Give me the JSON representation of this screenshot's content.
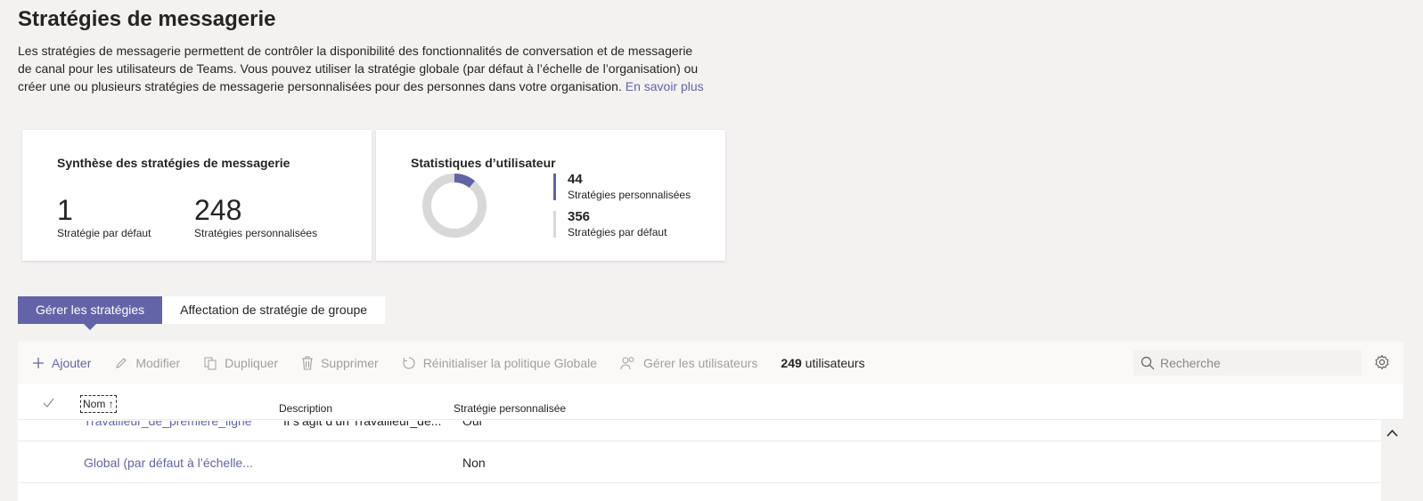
{
  "page": {
    "title": "Stratégies de messagerie",
    "intro": "Les stratégies de messagerie permettent de contrôler la disponibilité des fonctionnalités de conversation et de messagerie de canal pour les utilisateurs de Teams. Vous pouvez utiliser la stratégie globale (par défaut à l’échelle de l’organisation) ou créer une ou plusieurs stratégies de messagerie personnalisées pour des personnes dans votre organisation.",
    "learn_more": "En savoir plus"
  },
  "summary": {
    "title": "Synthèse des stratégies de messagerie",
    "default_count": "1",
    "default_label": "Stratégie par défaut",
    "custom_count": "248",
    "custom_label": "Stratégies personnalisées"
  },
  "user_stats": {
    "title": "Statistiques d’utilisateur",
    "custom_count": "44",
    "custom_label": "Stratégies personnalisées",
    "default_count": "356",
    "default_label": "Stratégies par défaut",
    "custom_fraction": 0.11,
    "colors": {
      "custom": "#6264a7",
      "default": "#d8d8d8"
    }
  },
  "tabs": [
    {
      "label": "Gérer les stratégies",
      "active": true
    },
    {
      "label": "Affectation de stratégie de groupe",
      "active": false
    }
  ],
  "toolbar": {
    "add": "Ajouter",
    "edit": "Modifier",
    "duplicate": "Dupliquer",
    "delete": "Supprimer",
    "reset": "Réinitialiser la politique Globale",
    "manage_users": "Gérer les utilisateurs",
    "users_count": "249",
    "users_label": "utilisateurs",
    "search_placeholder": "Recherche"
  },
  "table": {
    "columns": {
      "name": "Nom",
      "description": "Description",
      "custom": "Stratégie personnalisée"
    },
    "rows": [
      {
        "name": "Travailleur_de_première_ligne",
        "description": "Il s’agit d’un Travailleur_de...",
        "custom": "Oui"
      },
      {
        "name": "Global (par défaut à l’échelle...",
        "description": "",
        "custom": "Non"
      }
    ]
  },
  "colors": {
    "accent": "#6264a7",
    "background": "#f3f2f1"
  }
}
